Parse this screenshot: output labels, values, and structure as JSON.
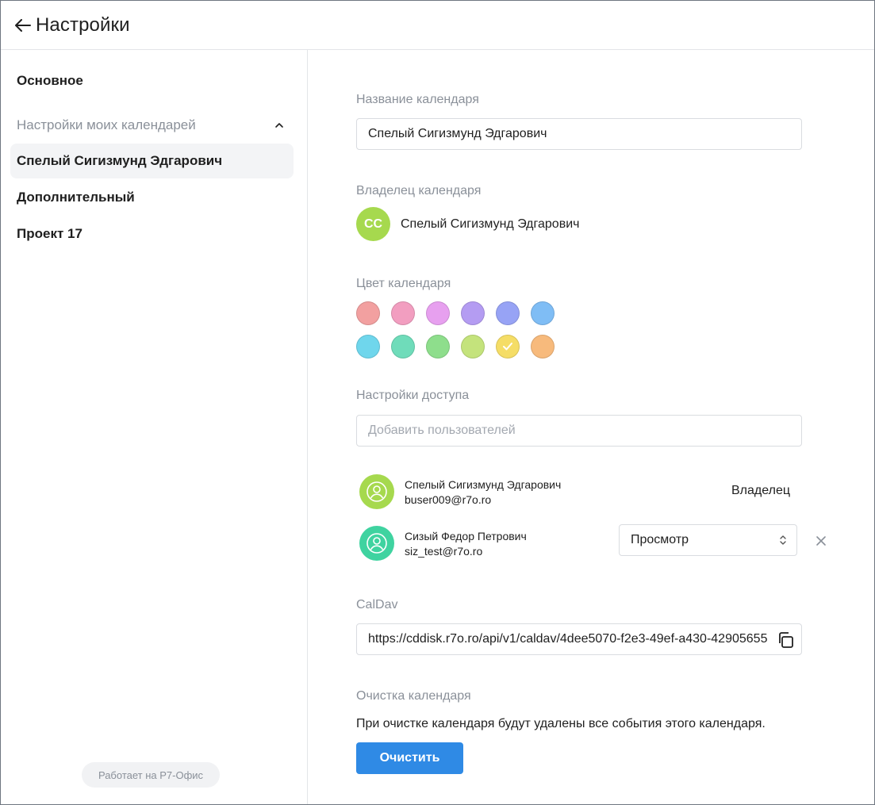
{
  "header": {
    "title": "Настройки"
  },
  "sidebar": {
    "general": "Основное",
    "group_label": "Настройки моих календарей",
    "items": [
      {
        "label": "Спелый Сигизмунд Эдгарович",
        "active": true
      },
      {
        "label": "Дополнительный",
        "active": false
      },
      {
        "label": "Проект 17",
        "active": false
      }
    ],
    "powered_by": "Работает на Р7-Офис"
  },
  "main": {
    "name_label": "Название календаря",
    "name_value": "Спелый Сигизмунд Эдгарович",
    "owner_label": "Владелец календаря",
    "owner": {
      "initials": "СС",
      "name": "Спелый Сигизмунд Эдгарович",
      "avatar_color": "#a6d94e"
    },
    "color_label": "Цвет календаря",
    "colors": [
      [
        "#f2a0a0",
        "#f29ec0",
        "#e7a0ef",
        "#b49cf2",
        "#97a3f5",
        "#7fbdf5"
      ],
      [
        "#6fd6ec",
        "#6fdcba",
        "#8ede8c",
        "#c4e37c",
        "#f5dd66",
        "#f7ba7c"
      ]
    ],
    "selected_color": "#f5dd66",
    "access_label": "Настройки доступа",
    "add_users_placeholder": "Добавить пользователей",
    "users": [
      {
        "name": "Спелый Сигизмунд Эдгарович",
        "email": "buser009@r7o.ro",
        "role": "Владелец",
        "avatar_color": "#a6d94e"
      },
      {
        "name": "Сизый Федор Петрович",
        "email": "siz_test@r7o.ro",
        "role": "Просмотр",
        "avatar_color": "#3fd3a0"
      }
    ],
    "caldav_label": "CalDav",
    "caldav_url": "https://cddisk.r7o.ro/api/v1/caldav/4dee5070-f2e3-49ef-a430-42905655",
    "clear_label": "Очистка календаря",
    "clear_text": "При очистке календаря будут удалены все события этого календаря.",
    "clear_button": "Очистить"
  }
}
